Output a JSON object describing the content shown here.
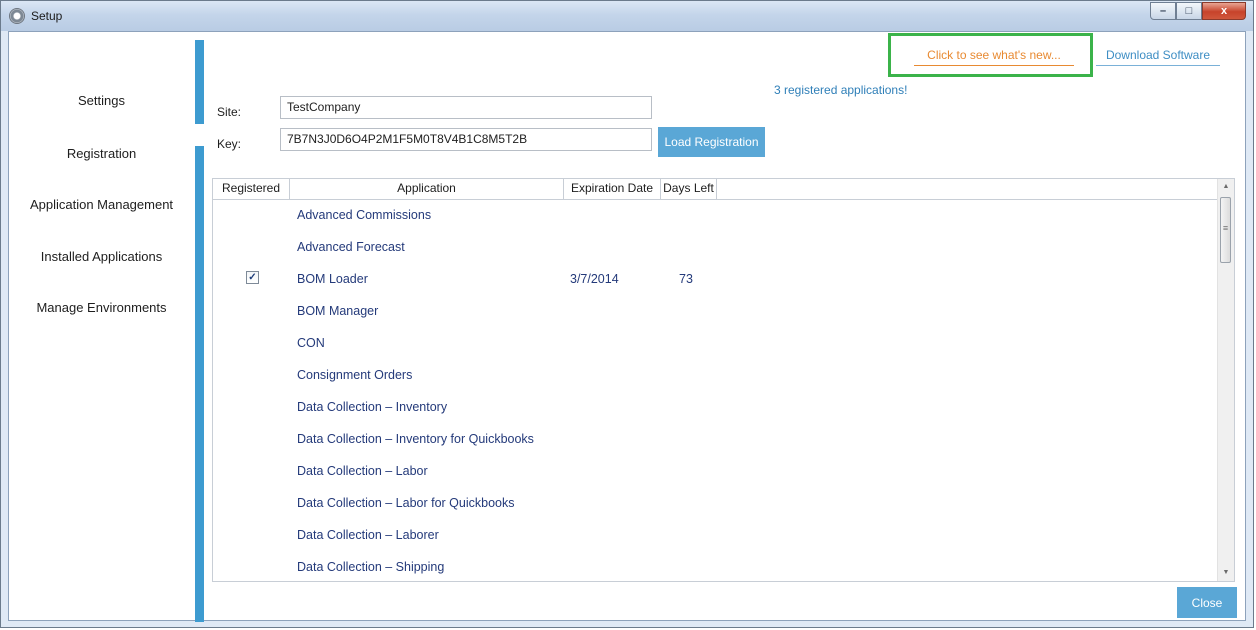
{
  "window": {
    "title": "Setup"
  },
  "window_buttons": {
    "minimize": "–",
    "maximize": "□",
    "close": "x"
  },
  "nav": [
    {
      "label": "Settings"
    },
    {
      "label": "Registration"
    },
    {
      "label": "Application Management"
    },
    {
      "label": "Installed Applications"
    },
    {
      "label": "Manage Environments"
    }
  ],
  "header": {
    "whats_new": "Click to see what's new...",
    "download": "Download Software",
    "registered_count": "3 registered applications!"
  },
  "form": {
    "site_label": "Site:",
    "site_value": "TestCompany",
    "key_label": "Key:",
    "key_value": "7B7N3J0D6O4P2M1F5M0T8V4B1C8M5T2B",
    "load_button": "Load Registration"
  },
  "grid": {
    "headers": [
      "Registered",
      "Application",
      "Expiration Date",
      "Days Left"
    ],
    "rows": [
      {
        "registered": false,
        "application": "Advanced Commissions",
        "expiration": "",
        "days": ""
      },
      {
        "registered": false,
        "application": "Advanced Forecast",
        "expiration": "",
        "days": ""
      },
      {
        "registered": true,
        "application": "BOM Loader",
        "expiration": "3/7/2014",
        "days": "73"
      },
      {
        "registered": false,
        "application": "BOM Manager",
        "expiration": "",
        "days": ""
      },
      {
        "registered": false,
        "application": "CON",
        "expiration": "",
        "days": ""
      },
      {
        "registered": false,
        "application": "Consignment Orders",
        "expiration": "",
        "days": ""
      },
      {
        "registered": false,
        "application": "Data Collection – Inventory",
        "expiration": "",
        "days": ""
      },
      {
        "registered": false,
        "application": "Data Collection – Inventory  for Quickbooks",
        "expiration": "",
        "days": ""
      },
      {
        "registered": false,
        "application": "Data Collection – Labor",
        "expiration": "",
        "days": ""
      },
      {
        "registered": false,
        "application": "Data Collection – Labor for Quickbooks",
        "expiration": "",
        "days": ""
      },
      {
        "registered": false,
        "application": "Data Collection – Laborer",
        "expiration": "",
        "days": ""
      },
      {
        "registered": false,
        "application": "Data Collection – Shipping",
        "expiration": "",
        "days": ""
      }
    ]
  },
  "footer": {
    "close_button": "Close"
  },
  "colors": {
    "accent": "#3d9bd0",
    "button": "#5aa7d6",
    "highlight_box": "#3bb34a",
    "whats_new": "#e88a32",
    "link": "#3e8ec4"
  }
}
